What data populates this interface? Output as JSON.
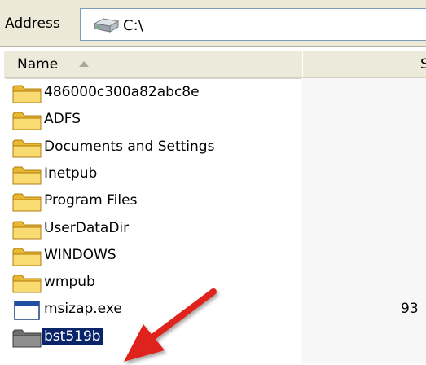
{
  "address": {
    "label_prefix": "A",
    "label_underline": "d",
    "label_suffix": "dress",
    "value": "C:\\",
    "drive_icon": "hard-drive-icon"
  },
  "columns": {
    "name": "Name",
    "size": "S"
  },
  "rows": [
    {
      "name": "486000c300a82abc8e",
      "icon": "folder-icon",
      "size": ""
    },
    {
      "name": "ADFS",
      "icon": "folder-icon",
      "size": ""
    },
    {
      "name": "Documents and Settings",
      "icon": "folder-icon",
      "size": ""
    },
    {
      "name": "Inetpub",
      "icon": "folder-icon",
      "size": ""
    },
    {
      "name": "Program Files",
      "icon": "folder-icon",
      "size": ""
    },
    {
      "name": "UserDataDir",
      "icon": "folder-icon",
      "size": ""
    },
    {
      "name": "WINDOWS",
      "icon": "folder-icon",
      "size": ""
    },
    {
      "name": "wmpub",
      "icon": "folder-icon",
      "size": ""
    },
    {
      "name": "msizap.exe",
      "icon": "exe-icon",
      "size": "93"
    },
    {
      "name": "bst519b",
      "icon": "folder-icon-selected",
      "size": ""
    }
  ],
  "colors": {
    "selection": "#0a246a",
    "arrow": "#e0201a",
    "folder": "#f5d46a"
  }
}
